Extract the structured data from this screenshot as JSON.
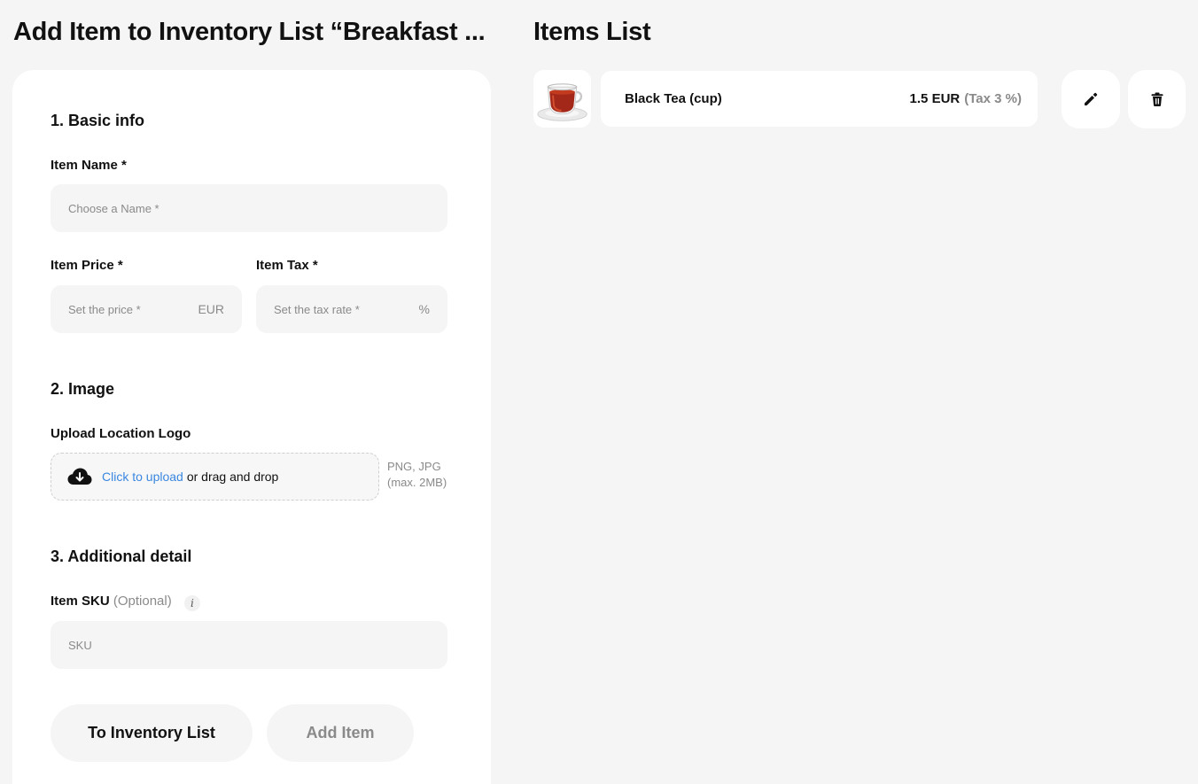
{
  "form": {
    "title": "Add Item to Inventory List “Breakfast ...",
    "section1": "1. Basic info",
    "item_name_label": "Item Name *",
    "item_name_placeholder": "Choose a Name *",
    "item_price_label": "Item Price *",
    "item_price_placeholder": "Set the price *",
    "item_price_suffix": "EUR",
    "item_tax_label": "Item Tax *",
    "item_tax_placeholder": "Set the tax rate *",
    "item_tax_suffix": "%",
    "section2": "2. Image",
    "upload_label": "Upload Location Logo",
    "upload_link": "Click to upload",
    "upload_rest": "or drag and drop",
    "upload_hint_line1": "PNG, JPG",
    "upload_hint_line2": "(max. 2MB)",
    "section3": "3. Additional detail",
    "sku_label": "Item SKU",
    "sku_optional": "(Optional)",
    "sku_info": "i",
    "sku_placeholder": "SKU",
    "to_inventory_button": "To Inventory List",
    "add_item_button": "Add Item"
  },
  "items_list": {
    "title": "Items List",
    "items": [
      {
        "name": "Black Tea (cup)",
        "price": "1.5 EUR",
        "tax": "(Tax 3 %)"
      }
    ]
  },
  "icons": {
    "upload": "cloud-upload-icon",
    "edit": "pencil-icon",
    "delete": "trash-icon",
    "info": "info-icon",
    "thumbnail": "tea-cup-image"
  },
  "colors": {
    "background": "#f5f5f5",
    "card": "#ffffff",
    "accent_link": "#3a87e0",
    "muted_text": "#8a8a8a",
    "tea": "#a3281a"
  }
}
